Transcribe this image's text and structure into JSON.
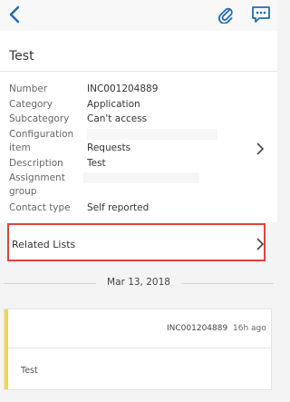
{
  "header": {
    "back_icon": "chevron-left-icon",
    "attach_icon": "paperclip-icon",
    "chat_icon": "chat-bubble-icon",
    "accent_color": "#1f6bb6"
  },
  "record": {
    "title": "Test",
    "fields": [
      {
        "label": "Number",
        "value": "INC001204889"
      },
      {
        "label": "Category",
        "value": "Application"
      },
      {
        "label": "Subcategory",
        "value": "Can't access"
      },
      {
        "label": "Configuration",
        "value": ""
      },
      {
        "label": "item",
        "value": "Requests"
      },
      {
        "label": "Description",
        "value": "Test"
      },
      {
        "label": "Assignment",
        "value": ""
      },
      {
        "label": "group",
        "value": ""
      },
      {
        "label": "Contact type",
        "value": "Self reported"
      }
    ]
  },
  "related": {
    "label": "Related Lists",
    "highlight_color": "#e0423c"
  },
  "activity": {
    "date": "Mar 13, 2018",
    "card": {
      "number": "INC001204889",
      "time": "16h ago",
      "text": "Test",
      "accent_color": "#f1d84b"
    }
  }
}
